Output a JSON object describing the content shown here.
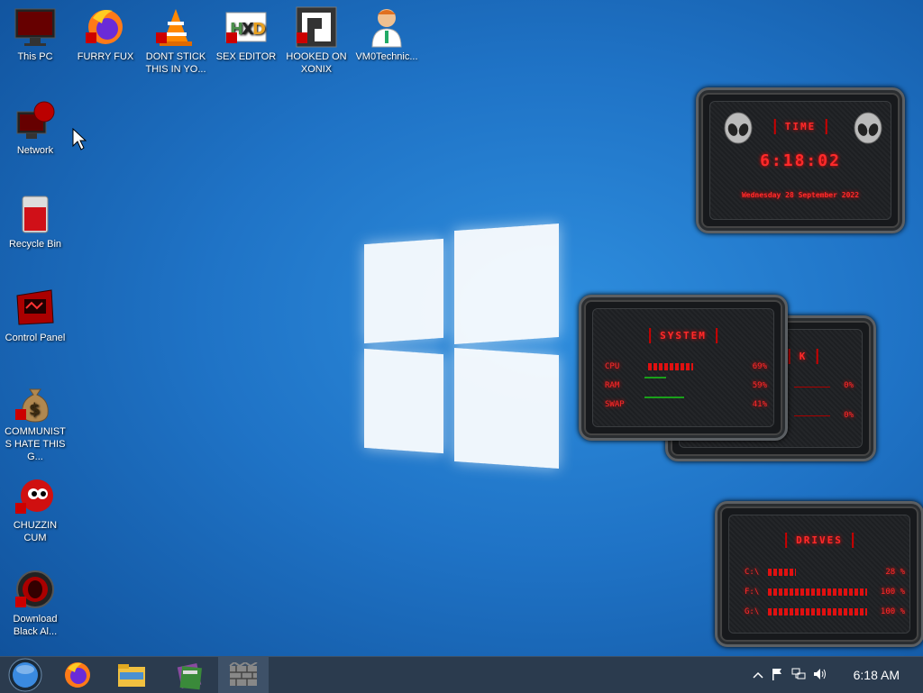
{
  "desktop_icons": [
    {
      "label": "This PC",
      "icon": "monitor-icon"
    },
    {
      "label": "FURRY FUX",
      "icon": "firefox-icon"
    },
    {
      "label": "DONT STICK THIS IN YO...",
      "icon": "vlc-icon"
    },
    {
      "label": "SEX EDITOR",
      "icon": "hxd-icon"
    },
    {
      "label": "HOOKED ON XONIX",
      "icon": "xonix-icon"
    },
    {
      "label": "VM0Technic...",
      "icon": "doctor-icon"
    },
    {
      "label": "Network",
      "icon": "network-icon"
    },
    {
      "label": "Recycle Bin",
      "icon": "recycle-bin-icon"
    },
    {
      "label": "Control Panel",
      "icon": "control-panel-icon"
    },
    {
      "label": "COMMUNISTS HATE THIS G...",
      "icon": "money-bag-icon"
    },
    {
      "label": "CHUZZIN CUM",
      "icon": "chuzzle-icon"
    },
    {
      "label": "Download Black Al...",
      "icon": "alien-icon"
    }
  ],
  "time_gadget": {
    "title": "TIME",
    "time": "6:18:02",
    "date": "Wednesday 28 September 2022"
  },
  "system_gadget": {
    "title": "SYSTEM",
    "rows": [
      {
        "label": "CPU",
        "value": "69%",
        "level": 0.69
      },
      {
        "label": "RAM",
        "value": "59%",
        "level": 0.59
      },
      {
        "label": "SWAP",
        "value": "41%",
        "level": 0.41
      }
    ],
    "behind_title": "K",
    "behind_values": [
      "0%",
      "0%"
    ]
  },
  "drives_gadget": {
    "title": "DRIVES",
    "rows": [
      {
        "label": "C:\\",
        "value": "28 %",
        "level": 0.28
      },
      {
        "label": "F:\\",
        "value": "100 %",
        "level": 1.0
      },
      {
        "label": "G:\\",
        "value": "100 %",
        "level": 1.0
      }
    ]
  },
  "taskbar": {
    "apps": [
      "start-orb-icon",
      "firefox-icon",
      "file-explorer-icon",
      "winrar-icon",
      "wall-app-icon"
    ],
    "clock": "6:18 AM"
  },
  "colors": {
    "accent_red": "#ff2a2a",
    "taskbar": "#2b3b4e",
    "desktop": "#1f73c6"
  }
}
